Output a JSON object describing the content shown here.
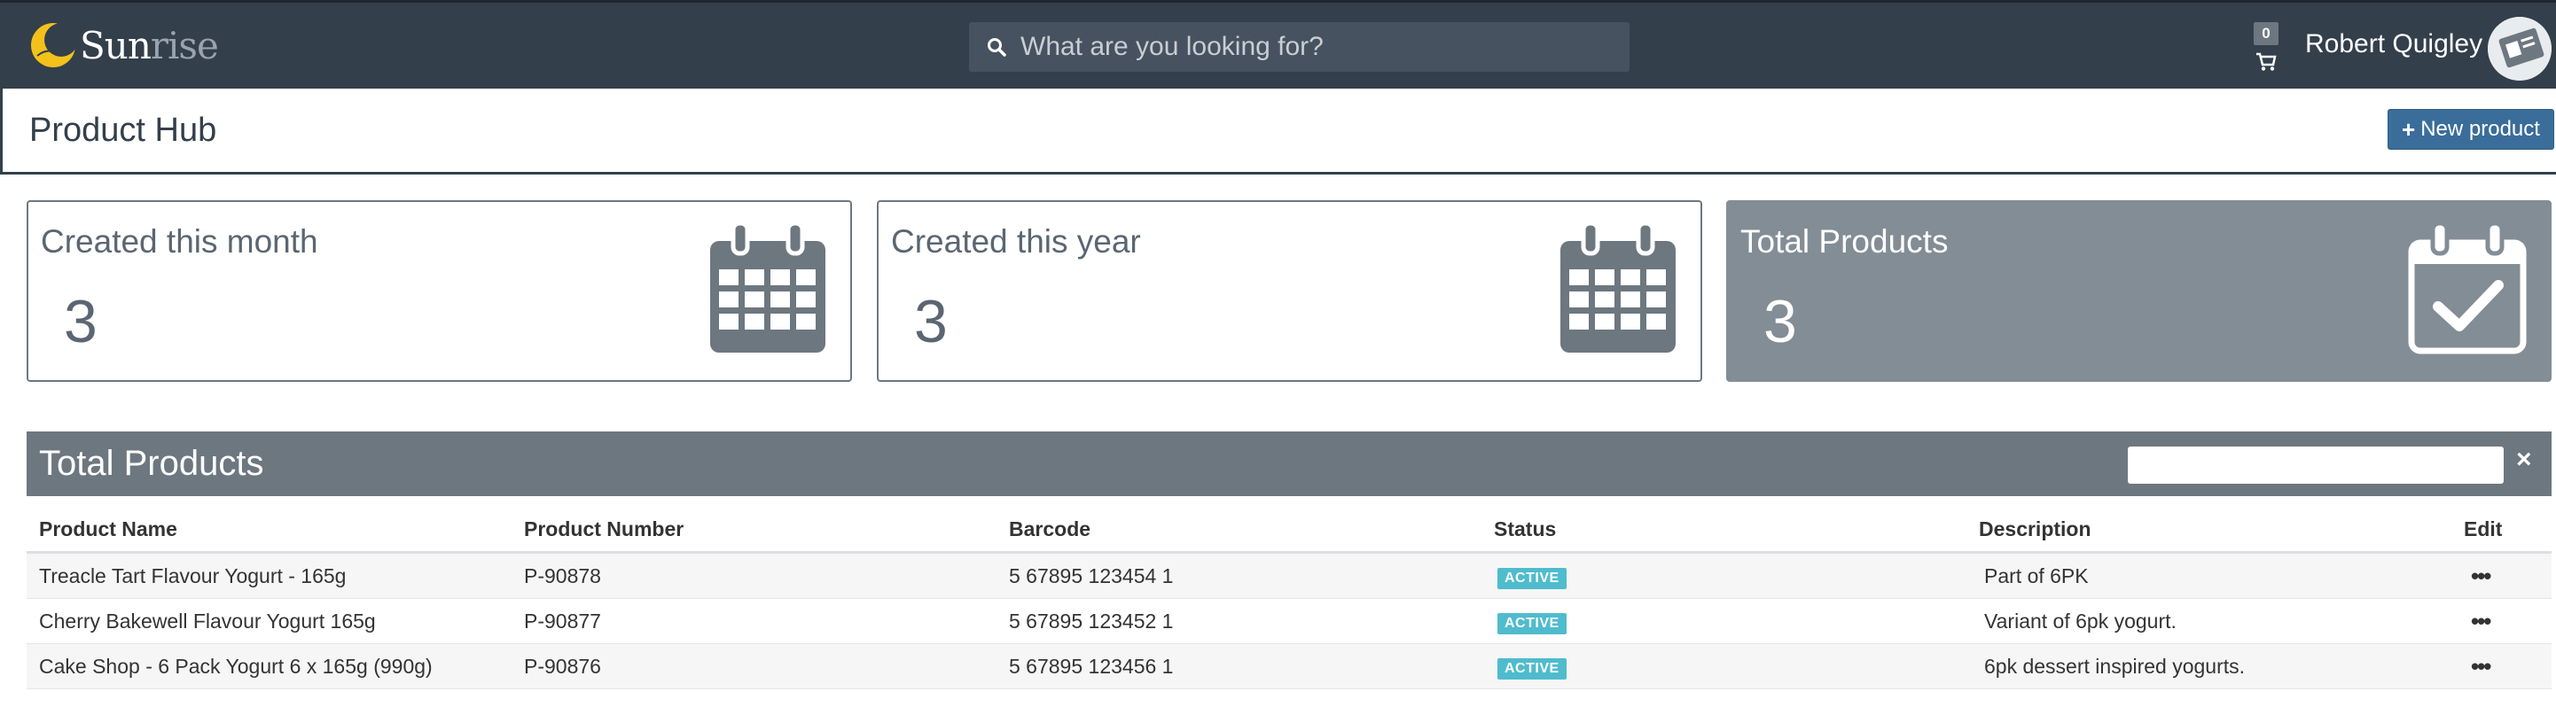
{
  "app": {
    "logo_text_a": "Sun",
    "logo_text_b": "rise",
    "search_placeholder": "What are you looking for?",
    "cart_count": "0",
    "user_name": "Robert Quigley"
  },
  "header": {
    "title": "Product Hub",
    "new_button": "New product"
  },
  "cards": [
    {
      "title": "Created this month",
      "value": "3",
      "icon": "calendar-icon"
    },
    {
      "title": "Created this year",
      "value": "3",
      "icon": "calendar-icon"
    },
    {
      "title": "Total Products",
      "value": "3",
      "icon": "calendar-check-icon"
    }
  ],
  "table": {
    "title": "Total Products",
    "filter_value": "",
    "close_symbol": "×",
    "columns": [
      "Product Name",
      "Product Number",
      "Barcode",
      "Status",
      "Description",
      "Edit"
    ],
    "rows": [
      {
        "name": "Treacle Tart Flavour Yogurt - 165g",
        "number": "P-90878",
        "barcode": "5 67895 123454 1",
        "status": "ACTIVE",
        "description": "Part of 6PK",
        "edit": "•••"
      },
      {
        "name": "Cherry Bakewell Flavour Yogurt 165g",
        "number": "P-90877",
        "barcode": "5 67895 123452 1",
        "status": "ACTIVE",
        "description": "Variant of 6pk yogurt.",
        "edit": "•••"
      },
      {
        "name": "Cake Shop - 6 Pack Yogurt 6 x 165g (990g)",
        "number": "P-90876",
        "barcode": "5 67895 123456 1",
        "status": "ACTIVE",
        "description": "6pk dessert inspired yogurts.",
        "edit": "•••"
      }
    ]
  },
  "colors": {
    "navbar": "#333f4b",
    "accent_button": "#3a6d9a",
    "panel": "#6d7780",
    "active_badge": "#4fbccd",
    "logo_sun": "#f2c21b"
  }
}
